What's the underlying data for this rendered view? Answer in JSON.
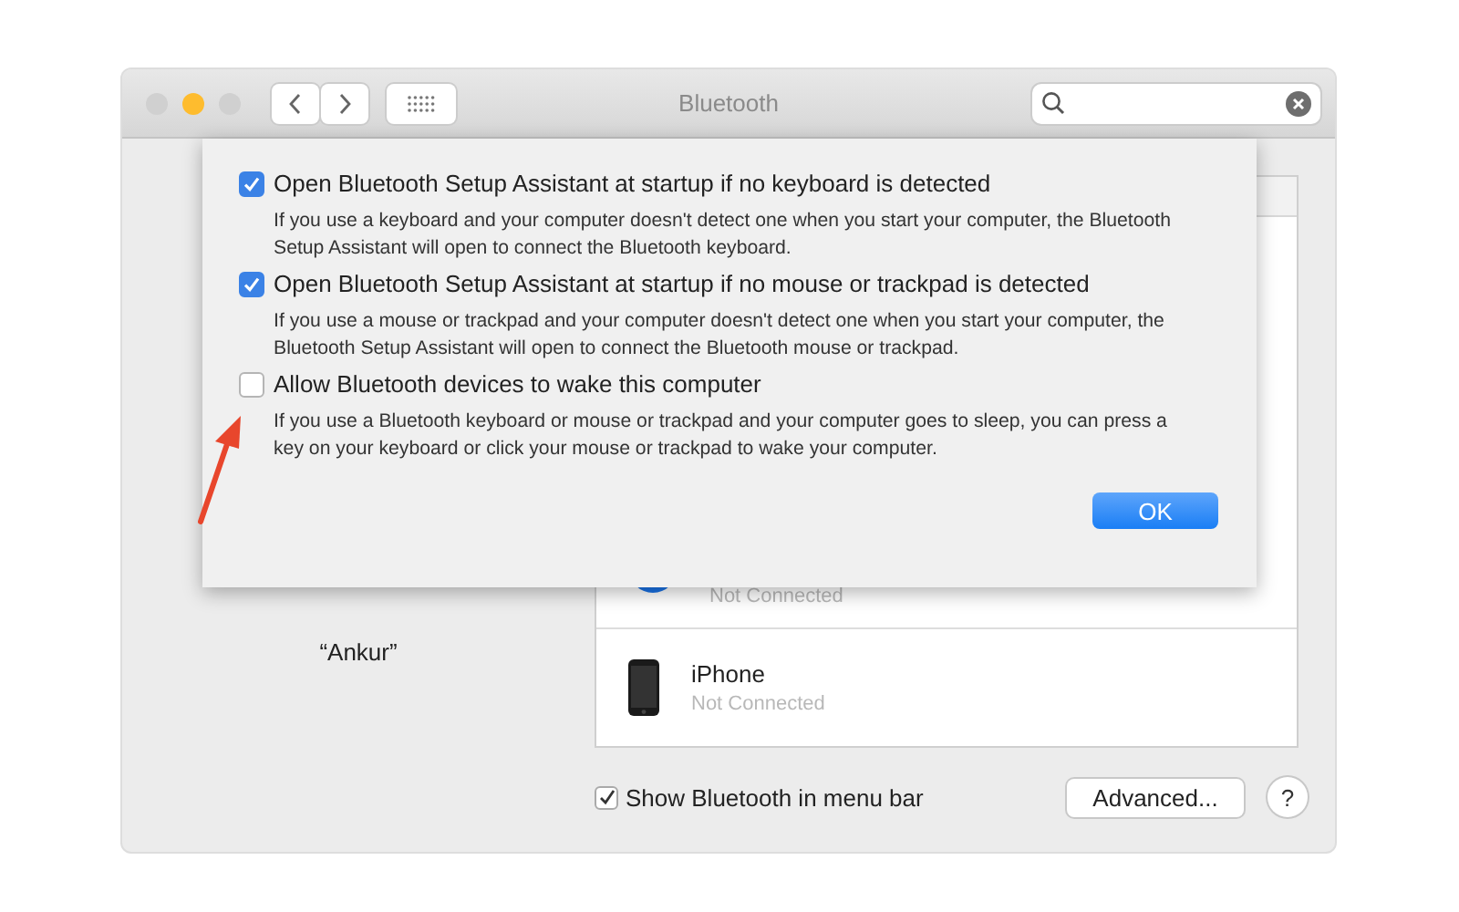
{
  "window": {
    "title": "Bluetooth",
    "controls": [
      {
        "kind": "close",
        "active": false
      },
      {
        "kind": "minimize",
        "active": true
      },
      {
        "kind": "zoom",
        "active": false
      }
    ]
  },
  "computer_name": "“Ankur”",
  "devices": [
    {
      "kind": "bluetooth",
      "status": "Not Connected"
    },
    {
      "kind": "phone",
      "name": "iPhone",
      "status": "Not Connected"
    }
  ],
  "show_in_menu_bar": {
    "label": "Show Bluetooth in menu bar",
    "checked": true
  },
  "advanced_button": "Advanced...",
  "help_button": "?",
  "sheet": {
    "options": [
      {
        "label": "Open Bluetooth Setup Assistant at startup if no keyboard is detected",
        "checked": true,
        "description": "If you use a keyboard and your computer doesn't detect one when you start your computer, the Bluetooth Setup Assistant will open to connect the Bluetooth keyboard."
      },
      {
        "label": "Open Bluetooth Setup Assistant at startup if no mouse or trackpad is detected",
        "checked": true,
        "description": "If you use a mouse or trackpad and your computer doesn't detect one when you start your computer, the Bluetooth Setup Assistant will open to connect the Bluetooth mouse or trackpad."
      },
      {
        "label": "Allow Bluetooth devices to wake this computer",
        "checked": false,
        "description": "If you use a Bluetooth keyboard or mouse or trackpad and your computer goes to sleep, you can press a key on your keyboard or click your mouse or trackpad to wake your computer."
      }
    ],
    "ok_button": "OK"
  },
  "annotation_arrow": true
}
